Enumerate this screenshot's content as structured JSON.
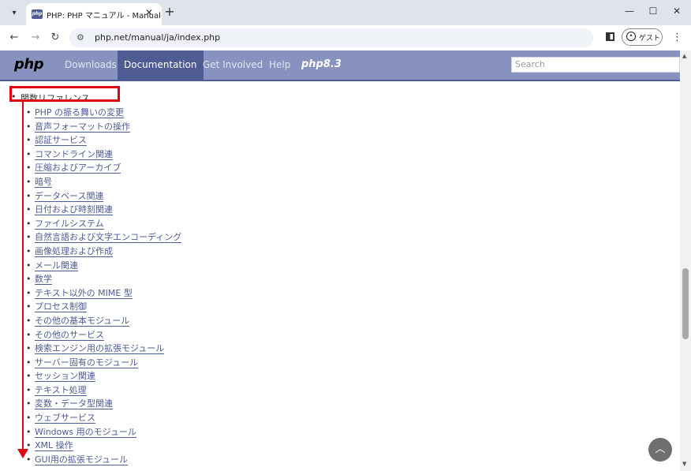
{
  "browser": {
    "tab_title": "PHP: PHP マニュアル - Manual",
    "favicon_text": "php",
    "new_tab": "+",
    "url": "php.net/manual/ja/index.php",
    "guest_label": "ゲスト"
  },
  "php_nav": {
    "logo": "php",
    "items": [
      "Downloads",
      "Documentation",
      "Get Involved",
      "Help"
    ],
    "active_item": "Documentation",
    "version_badge": "php8.3",
    "search_placeholder": "Search"
  },
  "content": {
    "top_item": "関数リファレンス",
    "items": [
      "PHP の振る舞いの変更",
      "音声フォーマットの操作",
      "認証サービス",
      "コマンドライン関連",
      "圧縮およびアーカイブ",
      "暗号",
      "データベース関連",
      "日付および時刻関連",
      "ファイルシステム",
      "自然言語および文字エンコーディング",
      "画像処理および作成",
      "メール関連",
      "数学",
      "テキスト以外の MIME 型",
      "プロセス制御",
      "その他の基本モジュール",
      "その他のサービス",
      "検索エンジン用の拡張モジュール",
      "サーバー固有のモジュール",
      "セッション関連",
      "テキスト処理",
      "変数・データ型関連",
      "ウェブサービス",
      "Windows 用のモジュール",
      "XML 操作",
      "GUI用の拡張モジュール"
    ]
  },
  "colors": {
    "php_nav_bg": "#8892bf",
    "php_nav_active": "#4f5b93",
    "link": "#4f5b93",
    "annotation": "#e0000f"
  }
}
